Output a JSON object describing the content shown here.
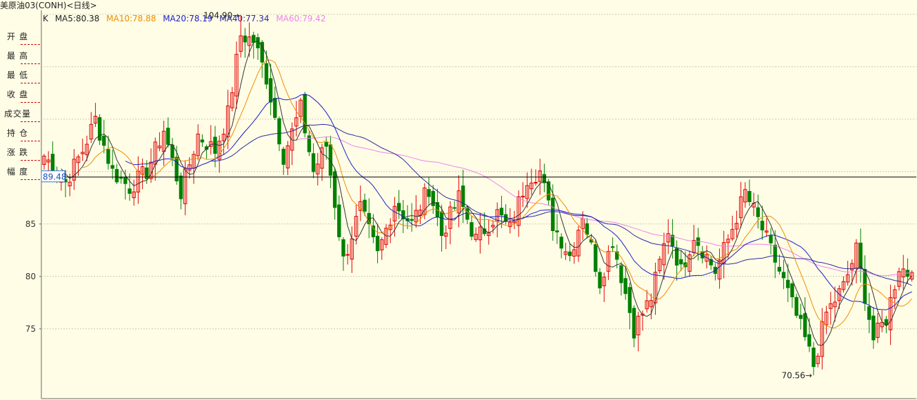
{
  "title": "美原油03(CONH)<日线>",
  "ma_bar": {
    "k_label": "K",
    "ma5": "MA5:80.38",
    "ma10": "MA10:78.88",
    "ma20": "MA20:78.19",
    "ma40": "MA40:77.34",
    "ma60": "MA60:79.42"
  },
  "info_panel": {
    "top_marker": "------",
    "rows": [
      {
        "label": "开盘",
        "value": ""
      },
      {
        "label": "最高",
        "value": ""
      },
      {
        "label": "最低",
        "value": ""
      },
      {
        "label": "收盘",
        "value": ""
      },
      {
        "label": "成交量",
        "value": ""
      },
      {
        "label": "持仓",
        "value": ""
      },
      {
        "label": "涨跌",
        "value": ""
      },
      {
        "label": "幅度",
        "value": ""
      }
    ]
  },
  "colors": {
    "background": "#fffde6",
    "up": "#e00000",
    "down": "#008000",
    "ma5": "#333333",
    "ma10": "#f08c00",
    "ma20": "#1c1cc8",
    "ma40": "#2a2aa0",
    "ma60": "#ee82ee",
    "crosshair": "#000000",
    "grid": "#c9c9b0"
  },
  "chart_data": {
    "type": "candlestick",
    "y_ticks": [
      "75",
      "80",
      "85"
    ],
    "y_tick_values": [
      75,
      80,
      85
    ],
    "ylim": [
      69,
      106
    ],
    "grid": true,
    "crosshair_value": 89.48,
    "crosshair_label": "89.48",
    "high_annotation": {
      "value": 104.9,
      "label": "104.90→",
      "index": 46
    },
    "low_annotation": {
      "value": 70.56,
      "label": "70.56→",
      "index": 180
    },
    "anchors": [
      [
        0,
        91.5
      ],
      [
        5,
        89.0
      ],
      [
        9,
        92.0
      ],
      [
        12,
        95.0
      ],
      [
        16,
        90.0
      ],
      [
        20,
        88.5
      ],
      [
        24,
        90.0
      ],
      [
        28,
        94.0
      ],
      [
        32,
        88.0
      ],
      [
        36,
        93.5
      ],
      [
        40,
        92.0
      ],
      [
        43,
        95.5
      ],
      [
        46,
        103.0
      ],
      [
        49,
        102.5
      ],
      [
        52,
        99.0
      ],
      [
        56,
        91.5
      ],
      [
        60,
        96.0
      ],
      [
        63,
        90.0
      ],
      [
        66,
        92.5
      ],
      [
        70,
        81.5
      ],
      [
        74,
        86.5
      ],
      [
        78,
        82.0
      ],
      [
        82,
        87.0
      ],
      [
        86,
        85.0
      ],
      [
        90,
        88.5
      ],
      [
        93,
        84.0
      ],
      [
        97,
        87.5
      ],
      [
        101,
        83.5
      ],
      [
        106,
        86.0
      ],
      [
        109,
        84.5
      ],
      [
        113,
        89.5
      ],
      [
        116,
        90.0
      ],
      [
        119,
        85.0
      ],
      [
        123,
        82.0
      ],
      [
        126,
        86.0
      ],
      [
        130,
        79.5
      ],
      [
        133,
        83.5
      ],
      [
        138,
        75.0
      ],
      [
        142,
        78.0
      ],
      [
        146,
        84.5
      ],
      [
        149,
        80.5
      ],
      [
        152,
        84.0
      ],
      [
        157,
        80.5
      ],
      [
        160,
        83.5
      ],
      [
        164,
        88.0
      ],
      [
        168,
        84.5
      ],
      [
        173,
        79.5
      ],
      [
        178,
        74.0
      ],
      [
        180,
        71.5
      ],
      [
        183,
        76.5
      ],
      [
        187,
        79.0
      ],
      [
        190,
        82.5
      ],
      [
        194,
        74.0
      ],
      [
        197,
        76.0
      ],
      [
        200,
        81.0
      ],
      [
        203,
        80.0
      ]
    ],
    "last_close": 80.38,
    "ma_last": {
      "ma5": 80.38,
      "ma10": 78.88,
      "ma20": 78.19,
      "ma40": 77.34,
      "ma60": 79.42
    }
  }
}
